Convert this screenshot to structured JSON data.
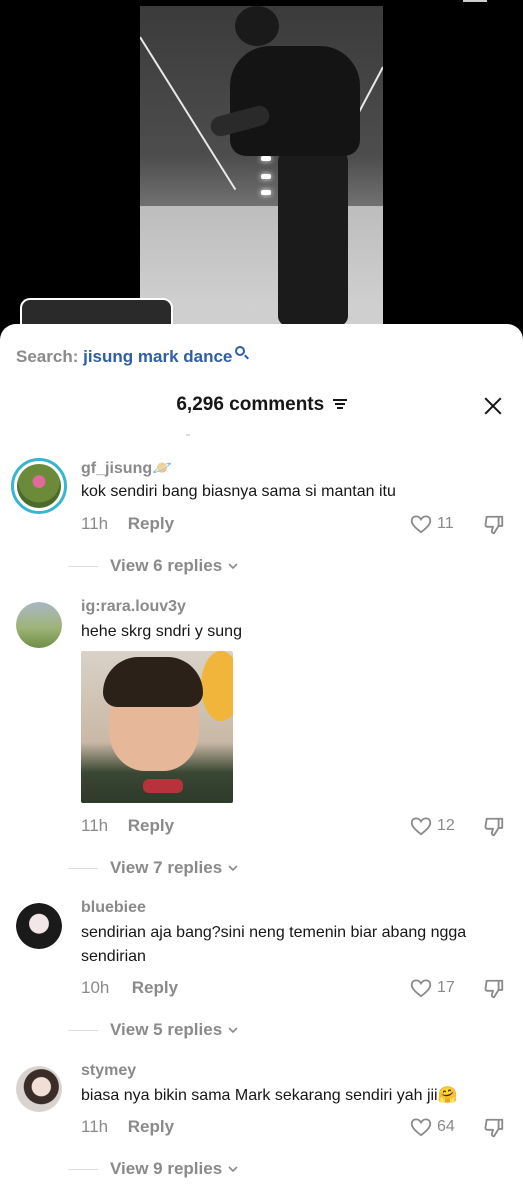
{
  "search": {
    "label": "Search:",
    "query": "jisung mark dance"
  },
  "header": {
    "count": "6,296 comments"
  },
  "comments": [
    {
      "username": "gf_jisung🪐",
      "text": "kok sendiri bang biasnya sama si mantan itu",
      "time": "11h",
      "reply": "Reply",
      "likes": "11",
      "view_replies": "View 6 replies"
    },
    {
      "username": "ig:rara.louv3y",
      "text": "hehe skrg sndri y sung",
      "time": "11h",
      "reply": "Reply",
      "likes": "12",
      "view_replies": "View 7 replies"
    },
    {
      "username": "bluebiee",
      "text": "sendirian aja bang?sini neng temenin biar abang ngga sendirian",
      "time": "10h",
      "reply": "Reply",
      "likes": "17",
      "view_replies": "View 5 replies"
    },
    {
      "username": "stymey",
      "text": "biasa nya bikin sama Mark sekarang sendiri yah jii🤗",
      "time": "11h",
      "reply": "Reply",
      "likes": "64",
      "view_replies": "View 9 replies"
    }
  ],
  "colors": {
    "accent": "#2e5ea8",
    "ring": "#37b6cf",
    "muted": "#8a8a8a"
  }
}
